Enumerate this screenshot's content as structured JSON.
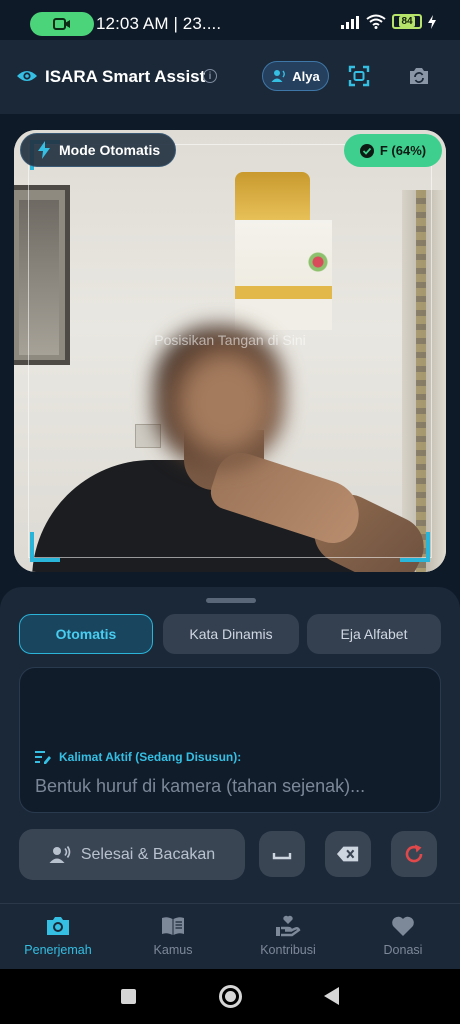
{
  "status_bar": {
    "time": "12:03 AM | 23....",
    "battery": "84",
    "icons": [
      "video-record-icon",
      "signal-icon",
      "wifi-icon",
      "battery-icon",
      "charging-icon"
    ]
  },
  "header": {
    "title": "ISARA Smart Assist",
    "user_name": "Alya",
    "icons": [
      "eye-icon",
      "info-icon",
      "user-voice-icon",
      "scan-frame-icon",
      "camera-flip-icon"
    ]
  },
  "camera": {
    "mode_label": "Mode Otomatis",
    "detection_label": "F (64%)",
    "hint_text": "Posisikan Tangan di Sini"
  },
  "modes": {
    "tabs": [
      {
        "label": "Otomatis",
        "active": true
      },
      {
        "label": "Kata Dinamis",
        "active": false
      },
      {
        "label": "Eja Alfabet",
        "active": false
      }
    ]
  },
  "sentence": {
    "label": "Kalimat Aktif (Sedang Disusun):",
    "placeholder": "Bentuk huruf di kamera (tahan sejenak)..."
  },
  "actions": {
    "finish_label": "Selesai & Bacakan",
    "icons": [
      "space-icon",
      "backspace-icon",
      "reset-icon"
    ]
  },
  "nav": {
    "items": [
      {
        "label": "Penerjemah",
        "icon": "camera-icon",
        "active": true
      },
      {
        "label": "Kamus",
        "icon": "book-icon",
        "active": false
      },
      {
        "label": "Kontribusi",
        "icon": "hand-heart-icon",
        "active": false
      },
      {
        "label": "Donasi",
        "icon": "heart-icon",
        "active": false
      }
    ]
  },
  "colors": {
    "accent": "#35bfe3",
    "success": "#3ecf8e",
    "danger": "#e0484a",
    "background": "#0f1a28",
    "surface": "#1b2838"
  }
}
